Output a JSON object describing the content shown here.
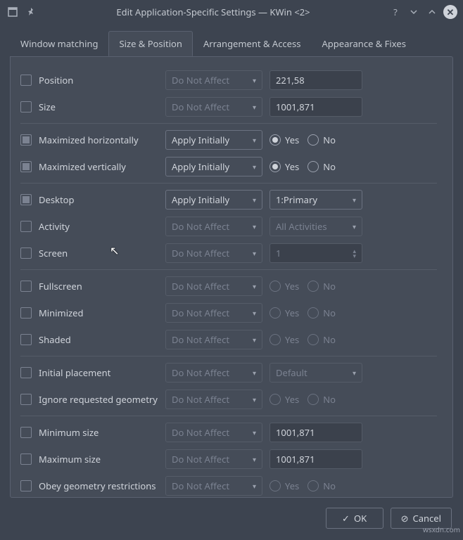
{
  "window": {
    "title": "Edit Application-Specific Settings — KWin <2>"
  },
  "tabs": {
    "t0": "Window matching",
    "t1": "Size & Position",
    "t2": "Arrangement & Access",
    "t3": "Appearance & Fixes"
  },
  "modes": {
    "do_not_affect": "Do Not Affect",
    "apply_initially": "Apply Initially"
  },
  "radios": {
    "yes": "Yes",
    "no": "No"
  },
  "rows": {
    "position": {
      "label": "Position",
      "value": "221,58"
    },
    "size": {
      "label": "Size",
      "value": "1001,871"
    },
    "max_h": {
      "label": "Maximized horizontally"
    },
    "max_v": {
      "label": "Maximized vertically"
    },
    "desktop": {
      "label": "Desktop",
      "value": "1:Primary"
    },
    "activity": {
      "label": "Activity",
      "value": "All Activities"
    },
    "screen": {
      "label": "Screen",
      "value": "1"
    },
    "fullscreen": {
      "label": "Fullscreen"
    },
    "minimized": {
      "label": "Minimized"
    },
    "shaded": {
      "label": "Shaded"
    },
    "placement": {
      "label": "Initial placement",
      "value": "Default"
    },
    "ignore_geo": {
      "label": "Ignore requested geometry"
    },
    "min_size": {
      "label": "Minimum size",
      "value": "1001,871"
    },
    "max_size": {
      "label": "Maximum size",
      "value": "1001,871"
    },
    "obey_geo": {
      "label": "Obey geometry restrictions"
    }
  },
  "footer": {
    "ok": "OK",
    "cancel": "Cancel"
  },
  "watermark": "wsxdn.com"
}
